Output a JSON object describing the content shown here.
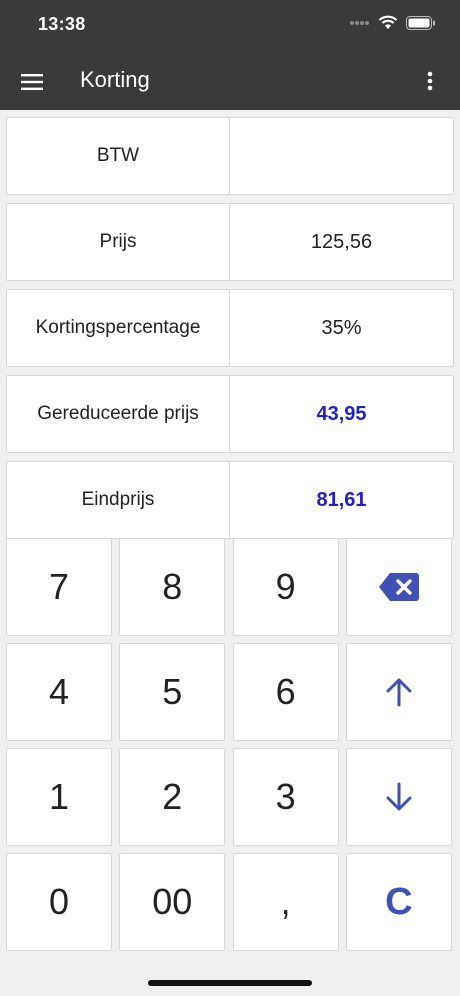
{
  "status": {
    "time": "13:38"
  },
  "appbar": {
    "title": "Korting",
    "menu_icon": "menu-icon",
    "more_icon": "more-vert-icon"
  },
  "rows": [
    {
      "label": "BTW",
      "value": ""
    },
    {
      "label": "Prijs",
      "value": "125,56"
    },
    {
      "label": "Kortingspercentage",
      "value": "35%"
    },
    {
      "label": "Gereduceerde prijs",
      "value": "43,95"
    },
    {
      "label": "Eindprijs",
      "value": "81,61"
    }
  ],
  "keypad": {
    "k7": "7",
    "k8": "8",
    "k9": "9",
    "k4": "4",
    "k5": "5",
    "k6": "6",
    "k1": "1",
    "k2": "2",
    "k3": "3",
    "k0": "0",
    "k00": "00",
    "comma": ",",
    "clear": "C",
    "icons": {
      "backspace": "backspace-icon",
      "up": "arrow-up-icon",
      "down": "arrow-down-icon"
    }
  },
  "colors": {
    "bar": "#3a3a3a",
    "result": "#2020c8",
    "accent": "#3f51b5",
    "background": "#efefef"
  }
}
